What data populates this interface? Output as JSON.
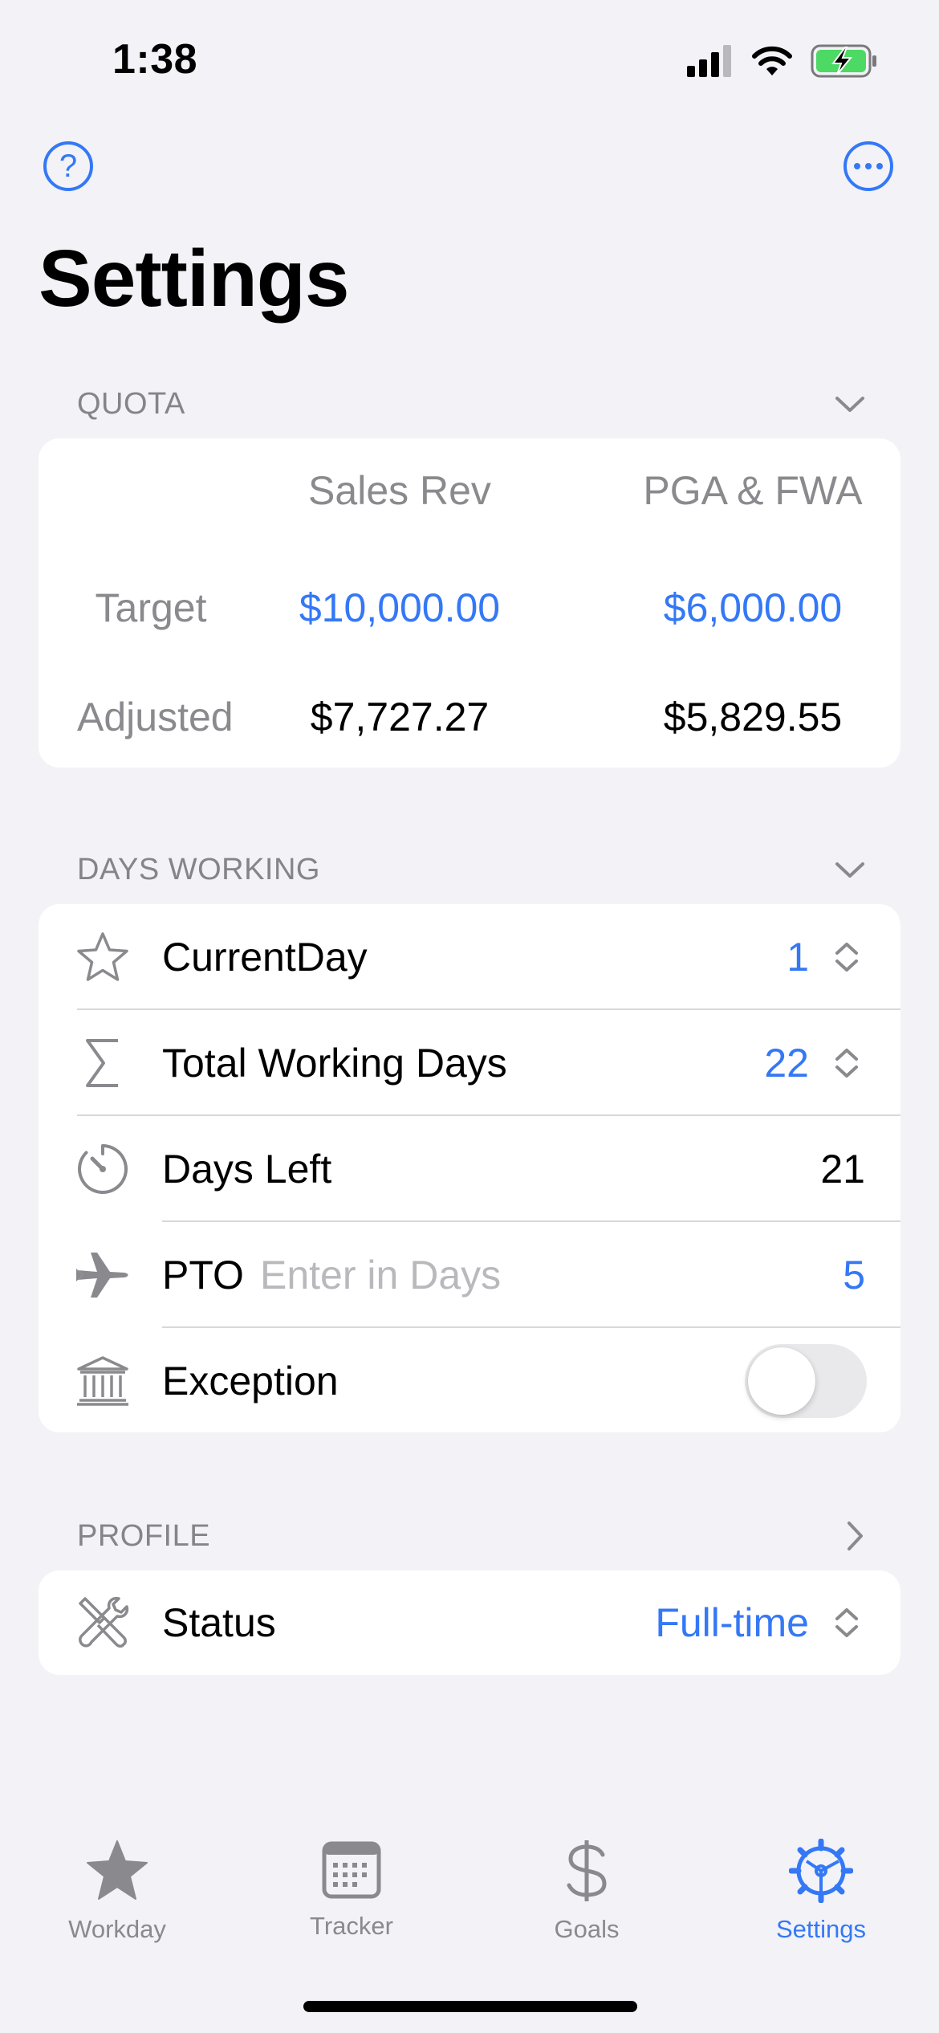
{
  "status_bar": {
    "time": "1:38"
  },
  "page": {
    "title": "Settings"
  },
  "quota": {
    "header": "QUOTA",
    "columns": [
      "Sales Rev",
      "PGA & FWA"
    ],
    "rows": [
      {
        "label": "Target",
        "values": [
          "$10,000.00",
          "$6,000.00"
        ]
      },
      {
        "label": "Adjusted",
        "values": [
          "$7,727.27",
          "$5,829.55"
        ]
      }
    ]
  },
  "days_working": {
    "header": "DAYS WORKING",
    "current_day": {
      "label": "CurrentDay",
      "value": "1",
      "icon": "star-icon"
    },
    "total_working_days": {
      "label": "Total Working Days",
      "value": "22",
      "icon": "sigma-icon"
    },
    "days_left": {
      "label": "Days Left",
      "value": "21",
      "icon": "timer-icon"
    },
    "pto": {
      "label": "PTO",
      "placeholder": "Enter in Days",
      "value": "5",
      "icon": "airplane-icon"
    },
    "exception": {
      "label": "Exception",
      "enabled": false,
      "icon": "bank-icon"
    }
  },
  "profile": {
    "header": "PROFILE",
    "status": {
      "label": "Status",
      "value": "Full-time",
      "icon": "tools-icon"
    }
  },
  "tab_bar": {
    "tabs": [
      {
        "label": "Workday",
        "icon": "star-fill-icon"
      },
      {
        "label": "Tracker",
        "icon": "calendar-icon"
      },
      {
        "label": "Goals",
        "icon": "dollar-icon"
      },
      {
        "label": "Settings",
        "icon": "gear-icon",
        "active": true
      }
    ]
  },
  "colors": {
    "accent": "#3478f6",
    "background": "#f2f2f7",
    "secondary_text": "#8a8a8e",
    "battery": "#4cd964"
  }
}
